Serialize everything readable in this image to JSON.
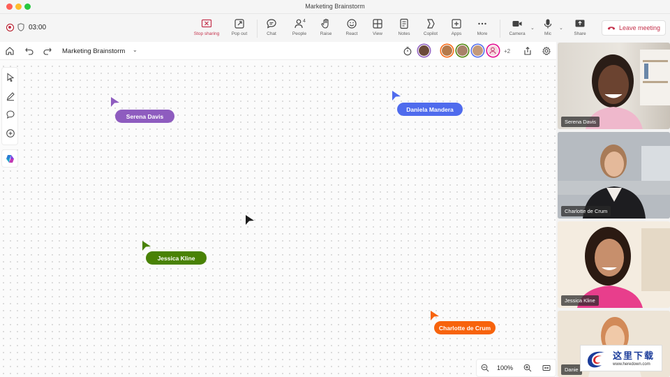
{
  "window": {
    "title": "Marketing Brainstorm"
  },
  "toolbar": {
    "timer": "03:00",
    "buttons": [
      {
        "id": "stop-sharing",
        "label": "Stop sharing",
        "icon": "stop-share-icon"
      },
      {
        "id": "pop-out",
        "label": "Pop out",
        "icon": "pop-out-icon"
      },
      {
        "id": "chat",
        "label": "Chat",
        "icon": "chat-icon"
      },
      {
        "id": "people",
        "label": "People",
        "icon": "people-icon",
        "badge": "4"
      },
      {
        "id": "raise",
        "label": "Raise",
        "icon": "raise-hand-icon"
      },
      {
        "id": "react",
        "label": "React",
        "icon": "react-icon"
      },
      {
        "id": "view",
        "label": "View",
        "icon": "view-icon"
      },
      {
        "id": "notes",
        "label": "Notes",
        "icon": "notes-icon"
      },
      {
        "id": "copilot",
        "label": "Copilot",
        "icon": "copilot-icon"
      },
      {
        "id": "apps",
        "label": "Apps",
        "icon": "apps-icon"
      },
      {
        "id": "more",
        "label": "More",
        "icon": "more-icon"
      },
      {
        "id": "camera",
        "label": "Camera",
        "icon": "camera-icon"
      },
      {
        "id": "mic",
        "label": "Mic",
        "icon": "mic-icon"
      },
      {
        "id": "share",
        "label": "Share",
        "icon": "share-icon"
      }
    ],
    "leave_label": "Leave meeting"
  },
  "board": {
    "name": "Marketing Brainstorm",
    "extra_participants": "+2",
    "zoom": "100%"
  },
  "cursors": [
    {
      "name": "Serena Davis",
      "color": "#8e5cbf"
    },
    {
      "name": "Daniela Mandera",
      "color": "#4f6bed"
    },
    {
      "name": "Jessica Kline",
      "color": "#498205"
    },
    {
      "name": "Charlotte de Crum",
      "color": "#f7630c"
    }
  ],
  "participants": [
    {
      "name": "Serena Davis"
    },
    {
      "name": "Charlotte de Crum"
    },
    {
      "name": "Jessica Kline"
    },
    {
      "name": "Danie"
    }
  ],
  "watermark": {
    "text": "这里下载",
    "url": "www.heredown.com"
  }
}
